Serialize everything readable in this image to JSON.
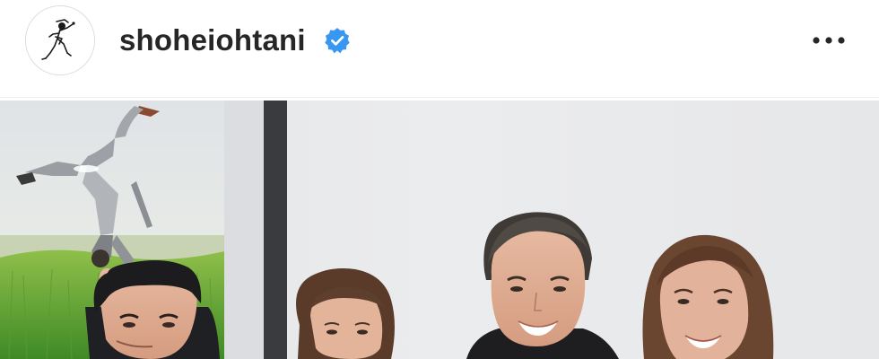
{
  "post": {
    "username": "shoheiohtani",
    "verified": true,
    "avatar_icon": "pitcher-sketch-icon",
    "more_icon": "more-options-icon",
    "badge_color": "#3897f0",
    "username_color": "#262626"
  }
}
